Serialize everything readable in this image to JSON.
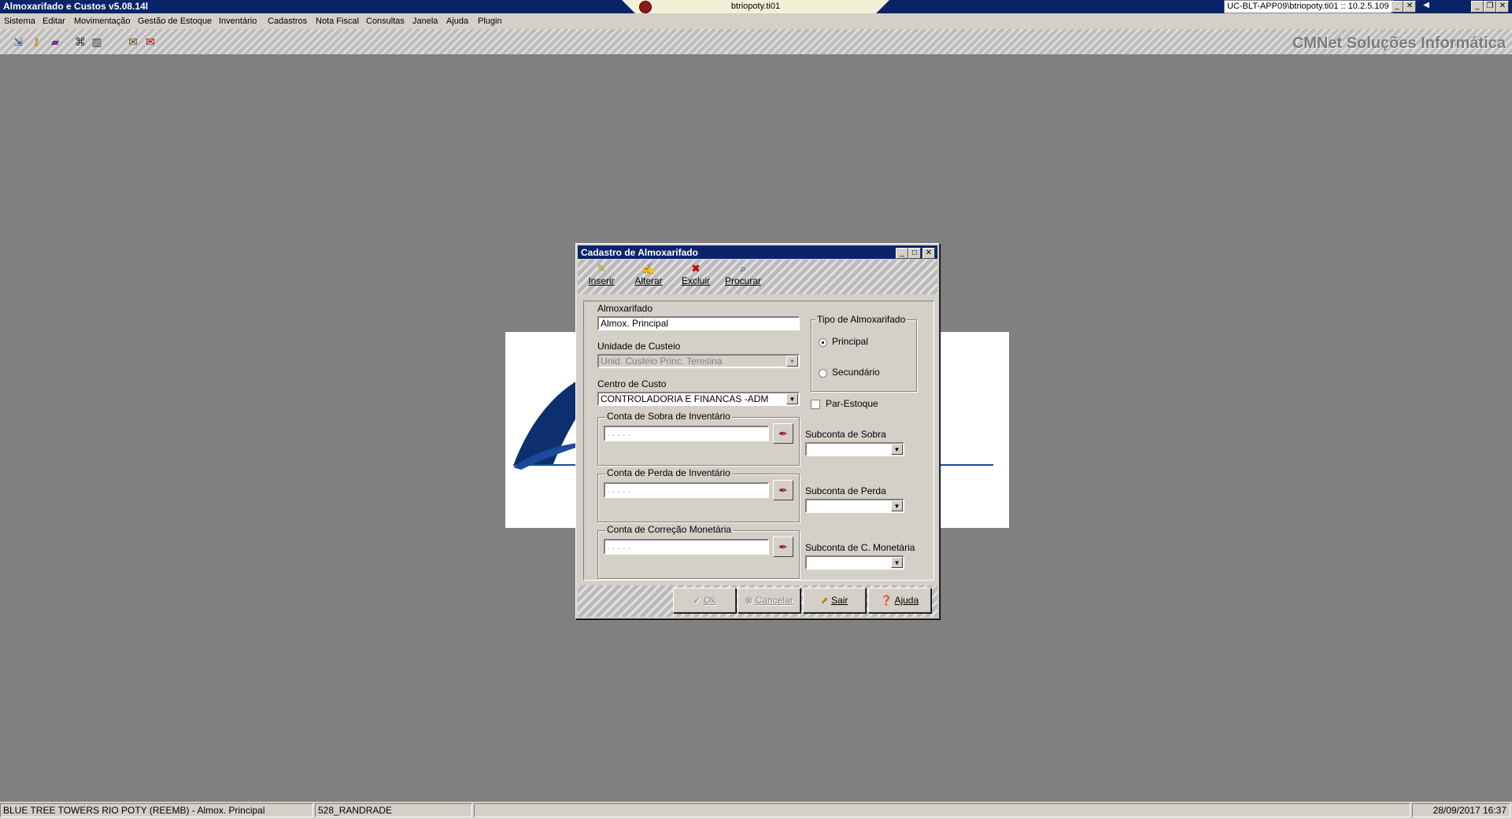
{
  "window": {
    "title": "Almoxarifado e Custos v5.08.14l",
    "rdp_title": "btriopoty.ti01",
    "connection": "UC-BLT-APP09\\btriopoty.ti01 :: 10.2.5.109"
  },
  "menu": [
    "Sistema",
    "Editar",
    "Movimentação",
    "Gestão de Estoque",
    "Inventário",
    "Cadastros",
    "Nota Fiscal",
    "Consultas",
    "Janela",
    "Ajuda",
    "Plugin"
  ],
  "toolbar": {
    "brand": "CMNet Soluções Informática"
  },
  "dialog": {
    "title": "Cadastro de Almoxarifado",
    "tools": {
      "insert": "Inserir",
      "edit": "Alterar",
      "delete": "Excluir",
      "search": "Procurar"
    },
    "almoxarifado_label": "Almoxarifado",
    "almoxarifado_value": "Almox. Principal",
    "unidade_label": "Unidade de Custeio",
    "unidade_value": "Unid. Custeio Princ. Teresina",
    "centro_label": "Centro de Custo",
    "centro_value": "CONTROLADORIA E FINANCAS -ADM",
    "tipo_label": "Tipo de Almoxarifado",
    "tipo_principal": "Principal",
    "tipo_secundario": "Secundário",
    "par_estoque": "Par-Estoque",
    "sobra_group": "Conta de Sobra de Inventário",
    "perda_group": "Conta de Perda de Inventário",
    "correcao_group": "Conta de Correção Monetária",
    "account_mask": ". . . . .",
    "subconta_sobra": "Subconta de Sobra",
    "subconta_perda": "Subconta de Perda",
    "subconta_correcao": "Subconta de C. Monetária",
    "buttons": {
      "ok": "Ok",
      "cancel": "Cancelar",
      "exit": "Sair",
      "help": "Ajuda"
    }
  },
  "status": {
    "company": "BLUE TREE TOWERS RIO POTY (REEMB) - Almox. Principal",
    "user": "528_RANDRADE",
    "datetime": "28/09/2017 16:37"
  },
  "colors": {
    "titlebar": "#0a246a",
    "desktop": "#808080",
    "face": "#d4d0c8"
  }
}
